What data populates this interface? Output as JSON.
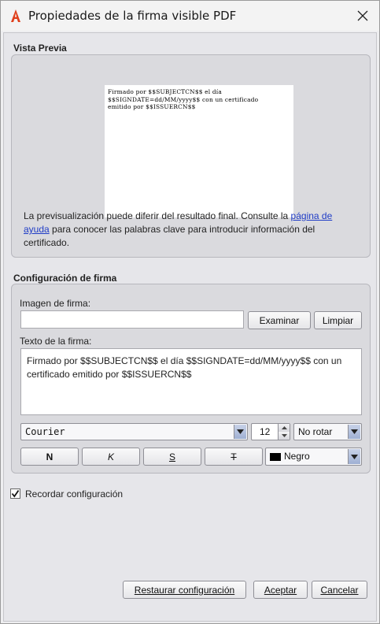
{
  "window": {
    "title": "Propiedades de la firma visible PDF",
    "app_icon": "acrobat-icon",
    "close_icon": "close-icon"
  },
  "preview_section": {
    "title": "Vista Previa",
    "preview_lines": [
      "Firmado por $$SUBJECTCN$$ el día",
      "$$SIGNDATE=dd/MM/yyyy$$ con un certificado",
      "emitido por $$ISSUERCN$$"
    ],
    "info_before_link": "La previsualización puede diferir del resultado final. Consulte la ",
    "link_text": "página de ayuda",
    "info_after_link": " para conocer las palabras clave para introducir información del certificado."
  },
  "config_section": {
    "title": "Configuración de firma",
    "image_label": "Imagen de firma:",
    "image_value": "",
    "browse_label": "Examinar",
    "clear_label": "Limpiar",
    "text_label": "Texto de la firma:",
    "text_value": "Firmado por $$SUBJECTCN$$ el día $$SIGNDATE=dd/MM/yyyy$$ con un certificado emitido por $$ISSUERCN$$",
    "font_value": "Courier",
    "size_value": "12",
    "rotation_value": "No rotar",
    "bold_label": "N",
    "italic_label": "K",
    "underline_label": "S",
    "strike_label": "T",
    "color_value": "Negro",
    "color_swatch": "#000000"
  },
  "remember": {
    "label": "Recordar configuración",
    "checked": true
  },
  "footer": {
    "restore_label": "Restaurar configuración",
    "accept_label": "Aceptar",
    "cancel_label": "Cancelar"
  }
}
